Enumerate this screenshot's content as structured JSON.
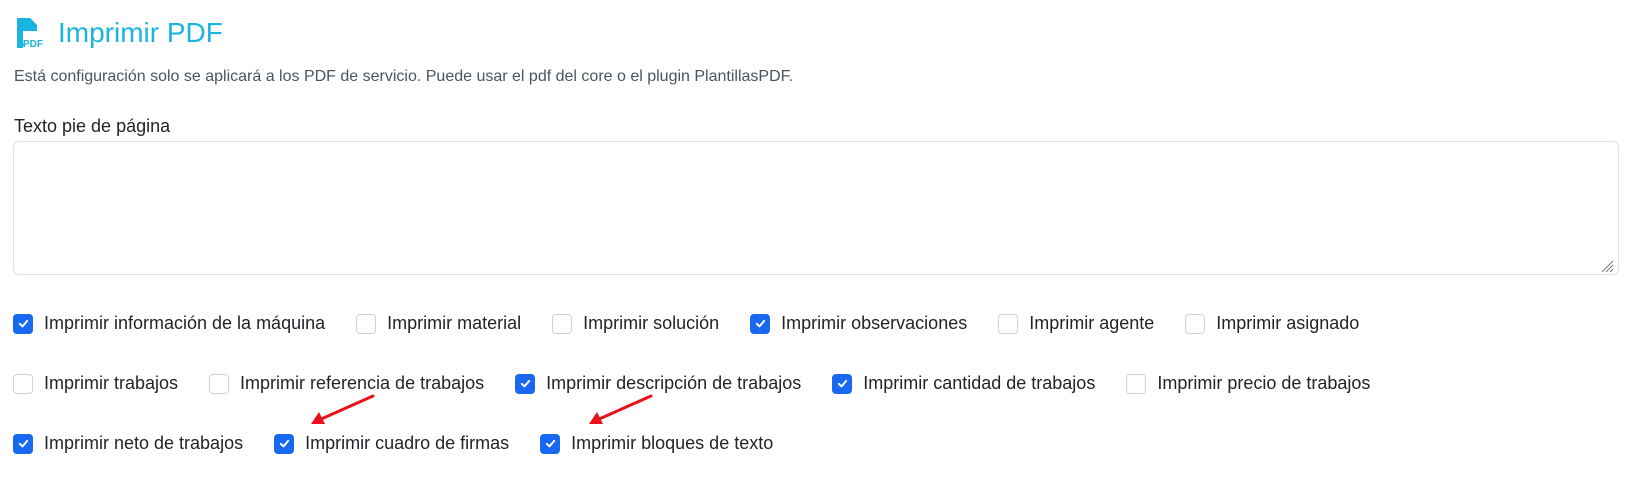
{
  "header": {
    "title": "Imprimir PDF",
    "icon": "file-pdf-icon",
    "accent": "#1ab4e0"
  },
  "description": "Está configuración solo se aplicará a los PDF de servicio. Puede usar el pdf del core o el plugin PlantillasPDF.",
  "footer_text": {
    "label": "Texto pie de página",
    "value": "",
    "placeholder": ""
  },
  "options": {
    "row1": [
      {
        "label": "Imprimir información de la máquina",
        "checked": true
      },
      {
        "label": "Imprimir material",
        "checked": false
      },
      {
        "label": "Imprimir solución",
        "checked": false
      },
      {
        "label": "Imprimir observaciones",
        "checked": true
      },
      {
        "label": "Imprimir agente",
        "checked": false
      },
      {
        "label": "Imprimir asignado",
        "checked": false
      }
    ],
    "row2": [
      {
        "label": "Imprimir trabajos",
        "checked": false
      },
      {
        "label": "Imprimir referencia de trabajos",
        "checked": false
      },
      {
        "label": "Imprimir descripción de trabajos",
        "checked": true
      },
      {
        "label": "Imprimir cantidad de trabajos",
        "checked": true
      },
      {
        "label": "Imprimir precio de trabajos",
        "checked": false
      }
    ],
    "row3": [
      {
        "label": "Imprimir neto de trabajos",
        "checked": true
      },
      {
        "label": "Imprimir cuadro de firmas",
        "checked": true
      },
      {
        "label": "Imprimir bloques de texto",
        "checked": true
      }
    ]
  },
  "colors": {
    "checkbox_checked": "#1868f2",
    "annotation_arrow": "#e8101a"
  }
}
